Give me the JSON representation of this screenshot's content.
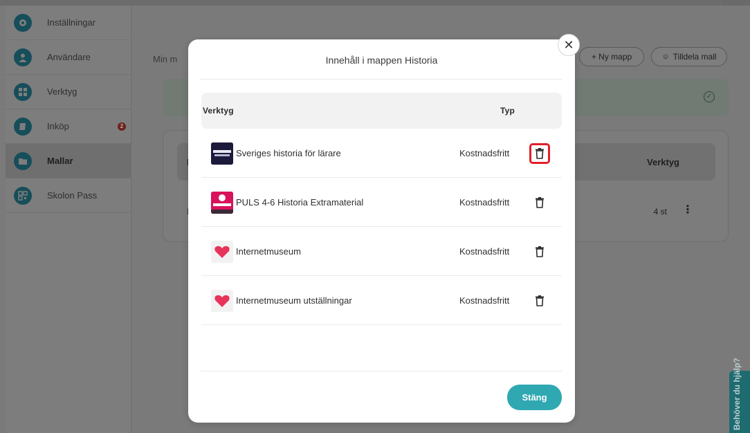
{
  "sidebar": {
    "items": [
      {
        "label": "Inställningar",
        "icon": "gear-icon"
      },
      {
        "label": "Användare",
        "icon": "user-icon"
      },
      {
        "label": "Verktyg",
        "icon": "grid-icon"
      },
      {
        "label": "Inköp",
        "icon": "book-icon",
        "badge": "2"
      },
      {
        "label": "Mallar",
        "icon": "folder-icon"
      },
      {
        "label": "Skolon Pass",
        "icon": "qr-icon"
      }
    ]
  },
  "main": {
    "title": "Min m",
    "new_folder": "+ Ny mapp",
    "assign_template": "Tilldela mall",
    "card": {
      "col_tools": "Verktyg",
      "row_first_letter": "N",
      "row_letter": "I",
      "row_count": "4 st"
    }
  },
  "help": {
    "label": "Behöver du hjälp?"
  },
  "modal": {
    "title": "Innehåll i mappen Historia",
    "col_tool": "Verktyg",
    "col_type": "Typ",
    "rows": [
      {
        "name": "Sveriges historia för lärare",
        "type": "Kostnadsfritt",
        "logo_text": "SVERIGES HISTORIA"
      },
      {
        "name": "PULS 4-6 Historia Extramaterial",
        "type": "Kostnadsfritt",
        "logo_text": "Historia"
      },
      {
        "name": "Internetmuseum",
        "type": "Kostnadsfritt"
      },
      {
        "name": "Internetmuseum utställningar",
        "type": "Kostnadsfritt"
      }
    ],
    "close_label": "Stäng"
  },
  "colors": {
    "accent": "#2fa8b1",
    "highlight": "#e0202a",
    "brand_dark": "#164e5a"
  }
}
